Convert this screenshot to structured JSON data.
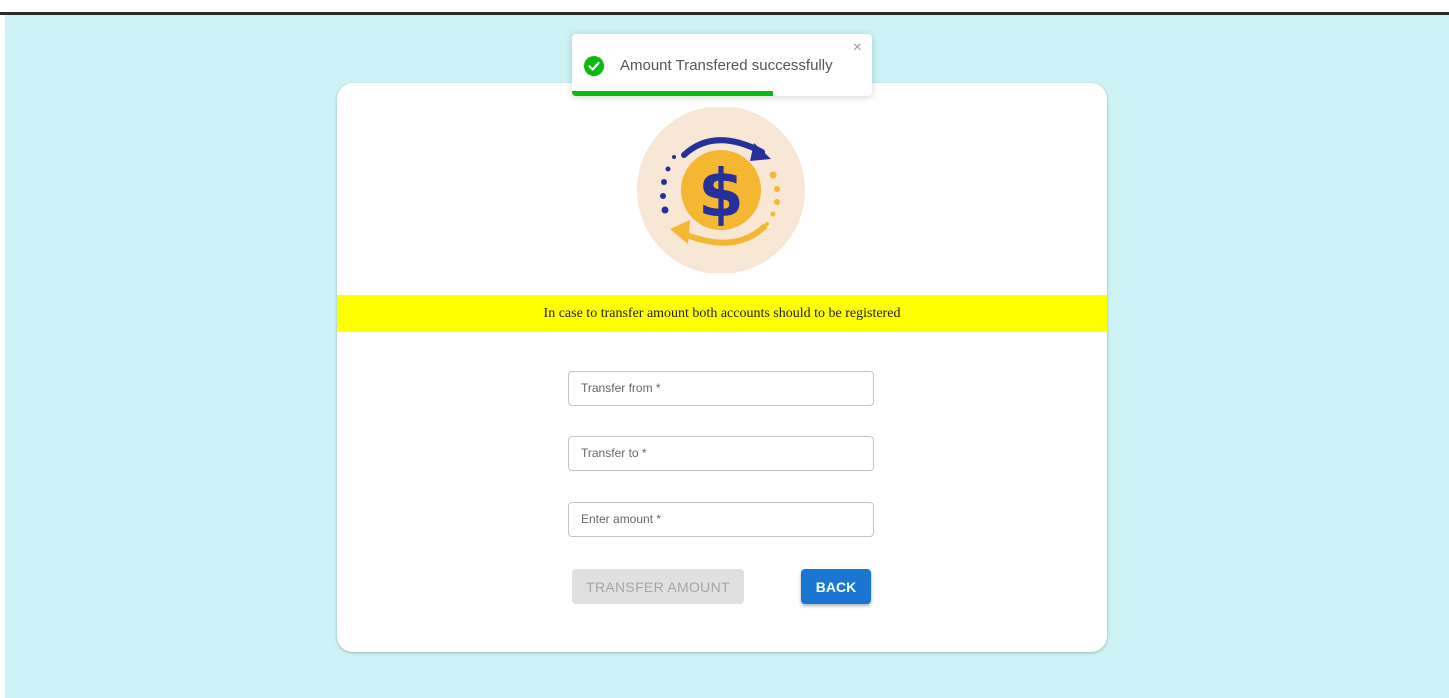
{
  "notice": {
    "text": "In case to transfer amount both accounts should to be registered"
  },
  "form": {
    "transfer_from_placeholder": "Transfer from *",
    "transfer_to_placeholder": "Transfer to *",
    "amount_placeholder": "Enter amount *",
    "transfer_button_label": "TRANSFER AMOUNT",
    "back_button_label": "BACK"
  },
  "toast": {
    "message": "Amount Transfered successfully",
    "close_glyph": "×",
    "icon": "check-circle-icon",
    "progress_fraction": 0.67
  },
  "illustration": {
    "icon": "money-transfer-icon",
    "glyph": "$"
  },
  "colors": {
    "background": "#cdf3f7",
    "notice_bar": "#ffff00",
    "primary_button": "#1976d2",
    "success": "#07bc0c",
    "coin": "#f5b731",
    "dollar": "#26309a"
  }
}
